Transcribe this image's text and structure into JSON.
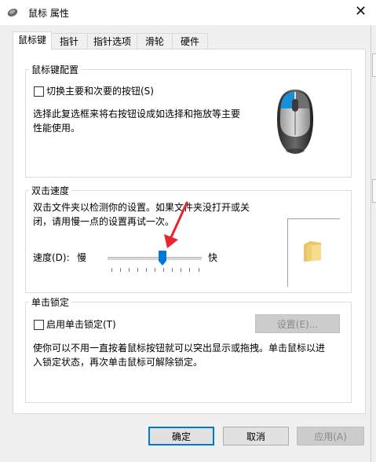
{
  "window": {
    "title": "鼠标 属性",
    "close_glyph": "✕"
  },
  "tabs": [
    {
      "label": "鼠标键",
      "active": true
    },
    {
      "label": "指针",
      "active": false
    },
    {
      "label": "指针选项",
      "active": false
    },
    {
      "label": "滑轮",
      "active": false
    },
    {
      "label": "硬件",
      "active": false
    }
  ],
  "button_config": {
    "group_label": "鼠标键配置",
    "switch_checkbox_label": "切换主要和次要的按钮(S)",
    "switch_checked": false,
    "description_line1": "选择此复选框来将右按钮设成如选择和拖放等主要",
    "description_line2": "性能使用。",
    "icon": "mouse-icon"
  },
  "double_click": {
    "group_label": "双击速度",
    "description_line1": "双击文件夹以检测你的设置。如果文件夹没打开或关",
    "description_line2": "闭，请用慢一点的设置再试一次。",
    "speed_label": "速度(D):",
    "slow_label": "慢",
    "fast_label": "快",
    "speed_value_fraction": 0.59,
    "test_icon": "folder-icon"
  },
  "click_lock": {
    "group_label": "单击锁定",
    "checkbox_label": "启用单击锁定(T)",
    "checked": false,
    "settings_button": "设置(E)...",
    "description_line1": "使你可以不用一直按着鼠标按钮就可以突出显示或拖拽。单击鼠标以进",
    "description_line2": "入锁定状态，再次单击鼠标可解除锁定。"
  },
  "footer": {
    "ok": "确定",
    "cancel": "取消",
    "apply": "应用(A)"
  },
  "colors": {
    "accent": "#0078d7",
    "annotation_arrow": "#e8262c"
  }
}
